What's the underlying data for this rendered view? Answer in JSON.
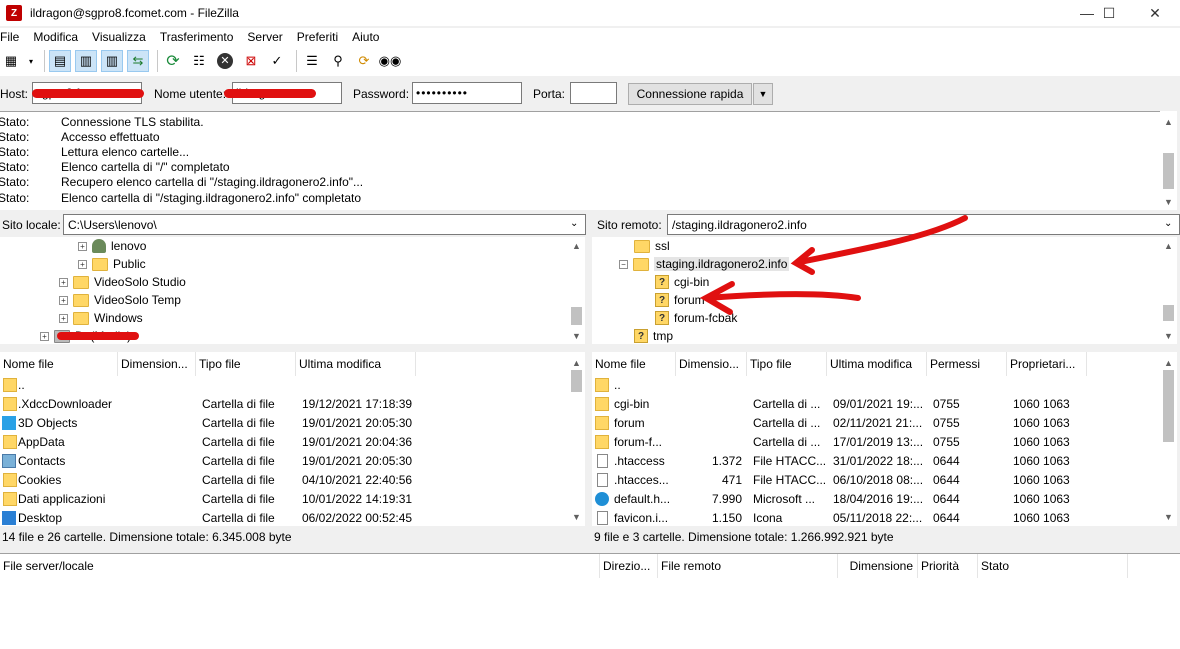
{
  "window": {
    "title": "ildragon@sgpro8.fcomet.com - FileZilla"
  },
  "menu": [
    "File",
    "Modifica",
    "Visualizza",
    "Trasferimento",
    "Server",
    "Preferiti",
    "Aiuto"
  ],
  "quickconnect": {
    "host_label": "Host:",
    "host_value": "sgpro8.fcomet.com",
    "user_label": "Nome utente:",
    "user_value": "ildragon",
    "password_label": "Password:",
    "password_value": "••••••••••",
    "port_label": "Porta:",
    "port_value": "",
    "connect_label": "Connessione rapida"
  },
  "log": [
    {
      "label": "Stato:",
      "text": "Connessione TLS stabilita."
    },
    {
      "label": "Stato:",
      "text": "Accesso effettuato"
    },
    {
      "label": "Stato:",
      "text": "Lettura elenco cartelle..."
    },
    {
      "label": "Stato:",
      "text": "Elenco cartella di \"/\" completato"
    },
    {
      "label": "Stato:",
      "text": "Recupero elenco cartella di \"/staging.ildragonero2.info\"..."
    },
    {
      "label": "Stato:",
      "text": "Elenco cartella di \"/staging.ildragonero2.info\" completato"
    }
  ],
  "local": {
    "site_label": "Sito locale:",
    "path": "C:\\Users\\lenovo\\",
    "tree": [
      "lenovo",
      "Public",
      "VideoSolo Studio",
      "VideoSolo Temp",
      "Windows",
      "D: (Media)"
    ],
    "columns": [
      "Nome file",
      "Dimension...",
      "Tipo file",
      "Ultima modifica"
    ],
    "files": [
      {
        "name": "..",
        "size": "",
        "type": "",
        "modified": ""
      },
      {
        "name": ".XdccDownloader",
        "size": "",
        "type": "Cartella di file",
        "modified": "19/12/2021 17:18:39"
      },
      {
        "name": "3D Objects",
        "size": "",
        "type": "Cartella di file",
        "modified": "19/01/2021 20:05:30"
      },
      {
        "name": "AppData",
        "size": "",
        "type": "Cartella di file",
        "modified": "19/01/2021 20:04:36"
      },
      {
        "name": "Contacts",
        "size": "",
        "type": "Cartella di file",
        "modified": "19/01/2021 20:05:30"
      },
      {
        "name": "Cookies",
        "size": "",
        "type": "Cartella di file",
        "modified": "04/10/2021 22:40:56"
      },
      {
        "name": "Dati applicazioni",
        "size": "",
        "type": "Cartella di file",
        "modified": "10/01/2022 14:19:31"
      },
      {
        "name": "Desktop",
        "size": "",
        "type": "Cartella di file",
        "modified": "06/02/2022 00:52:45"
      }
    ],
    "status": "14 file e 26 cartelle. Dimensione totale: 6.345.008 byte"
  },
  "remote": {
    "site_label": "Sito remoto:",
    "path": "/staging.ildragonero2.info",
    "tree": [
      "ssl",
      "staging.ildragonero2.info",
      "cgi-bin",
      "forum",
      "forum-fcbak",
      "tmp"
    ],
    "columns": [
      "Nome file",
      "Dimensio...",
      "Tipo file",
      "Ultima modifica",
      "Permessi",
      "Proprietari..."
    ],
    "files": [
      {
        "name": "..",
        "size": "",
        "type": "",
        "modified": "",
        "perm": "",
        "owner": ""
      },
      {
        "name": "cgi-bin",
        "size": "",
        "type": "Cartella di ...",
        "modified": "09/01/2021 19:...",
        "perm": "0755",
        "owner": "1060 1063"
      },
      {
        "name": "forum",
        "size": "",
        "type": "Cartella di ...",
        "modified": "02/11/2021 21:...",
        "perm": "0755",
        "owner": "1060 1063"
      },
      {
        "name": "forum-f...",
        "size": "",
        "type": "Cartella di ...",
        "modified": "17/01/2019 13:...",
        "perm": "0755",
        "owner": "1060 1063"
      },
      {
        "name": ".htaccess",
        "size": "1.372",
        "type": "File HTACC...",
        "modified": "31/01/2022 18:...",
        "perm": "0644",
        "owner": "1060 1063"
      },
      {
        "name": ".htacces...",
        "size": "471",
        "type": "File HTACC...",
        "modified": "06/10/2018 08:...",
        "perm": "0644",
        "owner": "1060 1063"
      },
      {
        "name": "default.h...",
        "size": "7.990",
        "type": "Microsoft ...",
        "modified": "18/04/2016 19:...",
        "perm": "0644",
        "owner": "1060 1063"
      },
      {
        "name": "favicon.i...",
        "size": "1.150",
        "type": "Icona",
        "modified": "05/11/2018 22:...",
        "perm": "0644",
        "owner": "1060 1063"
      }
    ],
    "status": "9 file e 3 cartelle. Dimensione totale: 1.266.992.921 byte"
  },
  "queue": {
    "columns": [
      "File server/locale",
      "Direzio...",
      "File remoto",
      "Dimensione",
      "Priorità",
      "Stato"
    ]
  },
  "colors": {
    "annotation": "#e01010",
    "folder": "#ffd766",
    "selection": "#cce4f7"
  }
}
